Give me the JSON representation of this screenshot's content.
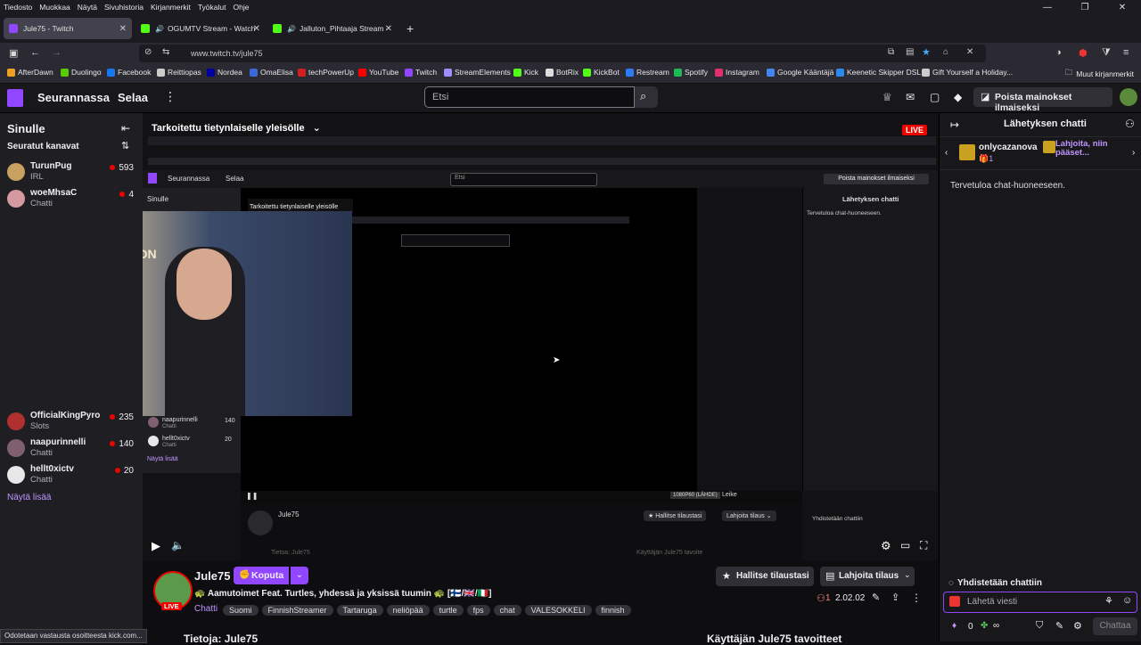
{
  "menu": [
    "Tiedosto",
    "Muokkaa",
    "Näytä",
    "Sivuhistoria",
    "Kirjanmerkit",
    "Työkalut",
    "Ohje"
  ],
  "tabs": [
    {
      "label": "Jule75 - Twitch",
      "active": true
    },
    {
      "label": "OGUMTV Stream - Watch L"
    },
    {
      "label": "Jalluton_Pihtaaja Stream - W"
    }
  ],
  "url": "www.twitch.tv/jule75",
  "bookmarks": [
    {
      "label": "AfterDawn",
      "color": "#f0a020"
    },
    {
      "label": "Duolingo",
      "color": "#58cc02"
    },
    {
      "label": "Facebook",
      "color": "#1877f2"
    },
    {
      "label": "Reittiopas",
      "color": "#cccccc"
    },
    {
      "label": "Nordea",
      "color": "#0000a0"
    },
    {
      "label": "OmaElisa",
      "color": "#3a6ad8"
    },
    {
      "label": "techPowerUp",
      "color": "#d02020"
    },
    {
      "label": "YouTube",
      "color": "#ff0000"
    },
    {
      "label": "Twitch",
      "color": "#9146ff"
    },
    {
      "label": "StreamElements",
      "color": "#a08cff"
    },
    {
      "label": "Kick",
      "color": "#53fc18"
    },
    {
      "label": "BotRix",
      "color": "#dddddd"
    },
    {
      "label": "KickBot",
      "color": "#53fc18"
    },
    {
      "label": "Restream",
      "color": "#2d7cf6"
    },
    {
      "label": "Spotify",
      "color": "#1db954"
    },
    {
      "label": "Instagram",
      "color": "#e1306c"
    },
    {
      "label": "Google Kääntäjä",
      "color": "#4285f4"
    },
    {
      "label": "Keenetic Skipper DSL",
      "color": "#2a8af0"
    },
    {
      "label": "Gift Yourself a Holiday...",
      "color": "#cccccc"
    }
  ],
  "other_bookmarks": "Muut kirjanmerkit",
  "twitch": {
    "following": "Seurannassa",
    "browse": "Selaa",
    "search_placeholder": "Etsi",
    "remove_ads": "Poista mainokset ilmaiseksi"
  },
  "sidebar": {
    "title": "Sinulle",
    "followed": "Seuratut kanavat",
    "channels": [
      {
        "name": "TurunPug",
        "game": "IRL",
        "viewers": "593",
        "color": "#c8a060"
      },
      {
        "name": "woeMhsaC",
        "game": "Chatti",
        "viewers": "4",
        "color": "#d49aa0"
      },
      {
        "name": "OfficialKingPyro",
        "game": "Slots",
        "viewers": "235",
        "color": "#b03030"
      },
      {
        "name": "naapurinnelli",
        "game": "Chatti",
        "viewers": "140",
        "color": "#806070"
      },
      {
        "name": "hellt0xictv",
        "game": "Chatti",
        "viewers": "20",
        "color": "#e8e8e8"
      }
    ],
    "show_more": "Näytä lisää"
  },
  "stream": {
    "overlay_title": "Tarkoitettu tietynlaiselle yleisölle",
    "live": "LIVE",
    "channel": "Jule75",
    "knock": "Koputa",
    "title": "🐢 Aamutoimet Feat. Turtles, yhdessä ja yksissä tuumin 🐢 [🇫🇮/🇬🇧/🇮🇹]",
    "category": "Chatti",
    "tags": [
      "Suomi",
      "FinnishStreamer",
      "Tartaruga",
      "neliöpää",
      "turtle",
      "fps",
      "chat",
      "VALESOKKELI",
      "finnish"
    ],
    "manage_subs": "Hallitse tilaustasi",
    "gift_sub": "Lahjoita tilaus",
    "viewers": "1",
    "uptime": "2.02.02",
    "about": "Tietoja: Jule75",
    "goals": "Käyttäjän Jule75 tavoitteet",
    "status": "Odotetaan vastausta osoitteesta kick.com..."
  },
  "chat": {
    "header": "Lähetyksen chatti",
    "gifter": "onlycazanova",
    "gift_count": "1",
    "gift_promo": "Lahjoita, niin pääset...",
    "welcome": "Tervetuloa chat-huoneeseen.",
    "connecting": "Yhdistetään chattiin",
    "input_placeholder": "Lähetä viesti",
    "points": "0",
    "send": "Chattaa"
  },
  "nested": {
    "title": "Tarkoitettu tietynlaiselle yleisölle",
    "channels": [
      {
        "name": "naapurinnelli",
        "game": "Chatti",
        "viewers": "140"
      },
      {
        "name": "hellt0xictv",
        "game": "Chatti",
        "viewers": "20"
      }
    ],
    "show_more": "Näytä lisää",
    "channel": "Jule75",
    "quality": "1080P60 (LÄHDE)",
    "clip": "Leike",
    "about": "Tietoa: Jule75",
    "goals": "Käyttäjän Jule75 tavoite"
  }
}
